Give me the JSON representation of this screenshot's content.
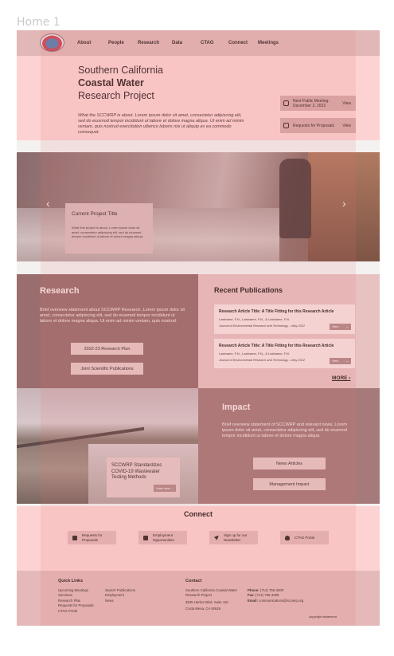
{
  "frame_label": "Home 1",
  "nav": {
    "logo_text": "SCCWRP",
    "links": [
      "About",
      "People",
      "Research",
      "Data",
      "CTAG",
      "Connect",
      "Meetings"
    ]
  },
  "hero": {
    "title_line1": "Southern California",
    "title_line2": "Coastal Water",
    "title_line3": "Research Project",
    "description": "What the SCCWRP is about. Lorem ipsum dolor sit amet, consectetur adipiscing elit, sed do eiusmod tempor incididunt ut labore et dolore magna aliqua. Ut enim ad minim veniam, quis nostrud exercitation ullamco laboris nisi ut aliquip ex ea commodo consequat.",
    "meeting_label": "Next Public Meeting: December 2, 2022",
    "meeting_action": "View",
    "proposals_label": "Requests for Proposals",
    "proposals_action": "View"
  },
  "carousel": {
    "prev": "‹",
    "next": "›",
    "card_title": "Current Project Title",
    "card_text": "What this project is about. Lorem ipsum dolor sit amet, consectetur adipiscing elit, sed do eiusmod tempor incididunt ut labore et dolore magna aliqua."
  },
  "research": {
    "title": "Research",
    "text": "Brief overview statement about SCCWRP Research. Lorem ipsum dolor sit amet, consectetur adipiscing elit, sed do eiusmod tempor incididunt ut labore et dolore magna aliqua. Ut enim ad minim veniam, quis nostrud.",
    "btn_plan": "2022-23 Research Plan",
    "btn_joint": "Joint Scientific Publications"
  },
  "publications": {
    "title": "Recent Publications",
    "items": [
      {
        "title": "Research Article Title: A Title Fitting for this Research Article",
        "authors": "Lastname, F.N., Lastname, F.N., & Lastname, F.N.",
        "journal": "Journal of Environmental Research and Technology – May 2022",
        "view": "View",
        "arrow": "→"
      },
      {
        "title": "Research Article Title: A Title Fitting for this Research Article",
        "authors": "Lastname, F.N., Lastname, F.N., & Lastname, F.N.",
        "journal": "Journal of Environmental Research and Technology – May 2022",
        "view": "View",
        "arrow": "→"
      }
    ],
    "more": "MORE ›"
  },
  "wastewater_card": {
    "title": "SCCWRP Standardizes COVID-19 Wastewater Testing Methods",
    "button": "Learn more",
    "arrow": "→"
  },
  "impact": {
    "title": "Impact",
    "text": "Brief overview statement of SCCWRP and relevant news. Lorem ipsum dolor sit amet, consectetur adipiscing elit, sed do eiusmod tempor incididunt ut labore et dolore magna aliqua.",
    "btn_news": "News Articles",
    "btn_mgmt": "Management Impact"
  },
  "connect": {
    "title": "Connect",
    "buttons": [
      {
        "label": "Requests for Proposals",
        "icon": "document-icon"
      },
      {
        "label": "Employment Opportunities",
        "icon": "briefcase-icon"
      },
      {
        "label": "Sign up for our Newsletter",
        "icon": "send-icon"
      },
      {
        "label": "CTAG Portal",
        "icon": "user-icon"
      }
    ]
  },
  "footer": {
    "quick_links_title": "Quick Links",
    "quick_links_col1": [
      "Upcoming Meetings",
      "Seminars",
      "Research Plan",
      "Requests for Proposals",
      "CTAG Portal"
    ],
    "quick_links_col2": [
      "Search Publications",
      "Employment",
      "News"
    ],
    "contact_title": "Contact",
    "org_name": "Southern California Coastal Water Research Project",
    "address1": "3535 Harbor Blvd, Suite 110",
    "address2": "Costa Mesa, CA 92626",
    "phone_label": "Phone:",
    "phone": "(714) 755-3200",
    "fax_label": "Fax:",
    "fax": "(714) 755-3299",
    "email_label": "Email:",
    "email": "communications@sccwrp.org",
    "copyright": "copyright statement"
  },
  "colors": {
    "nav_bg": "#e2b7b7",
    "hero_bg": "#fdd2d2",
    "research_bg": "#9a6e6e",
    "impact_bg": "#a67a7a",
    "overlay": "#e66e6e"
  }
}
